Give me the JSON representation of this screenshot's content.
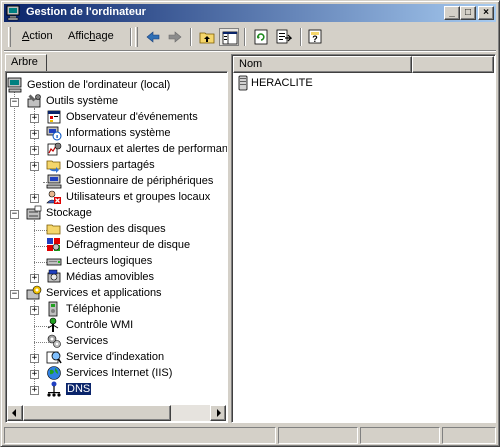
{
  "window": {
    "title": "Gestion de l'ordinateur",
    "controls": {
      "minimize": "_",
      "maximize": "□",
      "close": "×"
    }
  },
  "menu": {
    "items": [
      {
        "pre": "",
        "ul": "A",
        "post": "ction"
      },
      {
        "pre": "Affic",
        "ul": "h",
        "post": "age"
      }
    ]
  },
  "toolbar": {
    "buttons": [
      "back-arrow-icon",
      "forward-arrow-icon",
      "up-folder-icon",
      "show-hide-tree-icon",
      "refresh-icon",
      "export-list-icon",
      "help-icon"
    ]
  },
  "tree_tab": {
    "label": "Arbre"
  },
  "tree": {
    "root": "Gestion de l'ordinateur (local)",
    "system_tools": {
      "label": "Outils système",
      "event_viewer": "Observateur d'événements",
      "system_info": "Informations système",
      "perf_logs": "Journaux et alertes de performance",
      "shared_folders": "Dossiers partagés",
      "device_manager": "Gestionnaire de périphériques",
      "local_users": "Utilisateurs et groupes locaux"
    },
    "storage": {
      "label": "Stockage",
      "disk_management": "Gestion des disques",
      "defrag": "Défragmenteur de disque",
      "logical_drives": "Lecteurs logiques",
      "removable_media": "Médias amovibles"
    },
    "services_apps": {
      "label": "Services et applications",
      "telephony": "Téléphonie",
      "wmi": "Contrôle WMI",
      "services": "Services",
      "indexing": "Service d'indexation",
      "iis": "Services Internet (IIS)",
      "dns": "DNS"
    }
  },
  "list": {
    "columns": [
      "Nom"
    ],
    "items": [
      "HERACLITE"
    ]
  },
  "colors": {
    "title_gradient_start": "#0a246a",
    "title_gradient_end": "#a6caf0",
    "face": "#d4d0c8",
    "selection": "#0a246a"
  }
}
